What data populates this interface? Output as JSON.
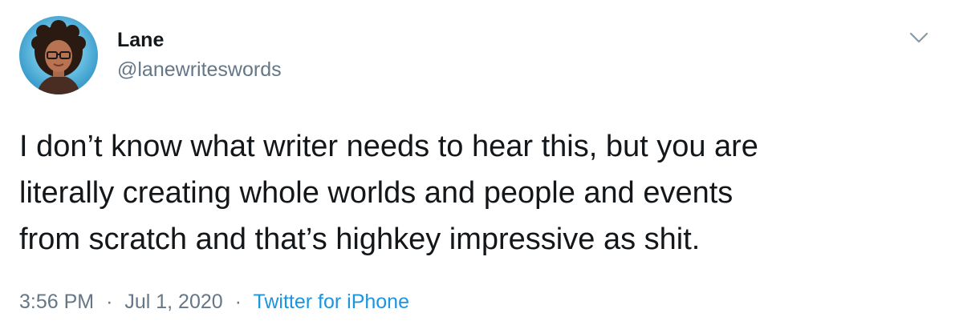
{
  "author": {
    "name": "Lane",
    "handle": "@lanewriteswords",
    "avatar_icon": "avatar-illustration"
  },
  "menu": {
    "icon": "chevron-down-icon"
  },
  "tweet": {
    "lines": [
      "I don’t know what writer needs to hear this, but you are",
      "literally creating whole worlds and people and events",
      "from scratch and that’s highkey impressive as shit."
    ]
  },
  "meta": {
    "time": "3:56 PM",
    "separator": "·",
    "date": "Jul 1, 2020",
    "source": "Twitter for iPhone"
  },
  "colors": {
    "text": "#14171a",
    "secondary": "#657786",
    "link": "#1b95e0",
    "background": "#ffffff"
  }
}
